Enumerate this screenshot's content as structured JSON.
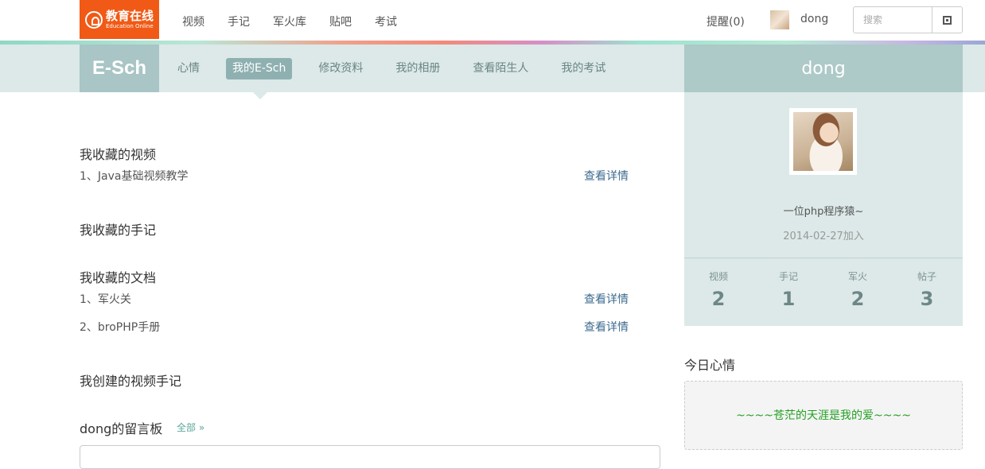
{
  "header": {
    "logo": {
      "cn": "教育在线",
      "en": "Education Online"
    },
    "nav": [
      "视频",
      "手记",
      "军火库",
      "贴吧",
      "考试"
    ],
    "remind": "提醒(0)",
    "username": "dong",
    "search_placeholder": "搜索"
  },
  "subnav": {
    "brand": "E-Sch",
    "items": [
      "心情",
      "我的E-Sch",
      "修改资料",
      "我的相册",
      "查看陌生人",
      "我的考试"
    ],
    "active_index": 1
  },
  "main": {
    "videos_title": "我收藏的视频",
    "videos": [
      {
        "text": "1、Java基础视频教学",
        "link": "查看详情"
      }
    ],
    "notes_title": "我收藏的手记",
    "docs_title": "我收藏的文档",
    "docs": [
      {
        "text": "1、军火关",
        "link": "查看详情"
      },
      {
        "text": "2、broPHP手册",
        "link": "查看详情"
      }
    ],
    "created_title": "我创建的视频手记",
    "board_title": "dong的留言板",
    "board_all": "全部 »"
  },
  "profile": {
    "name": "dong",
    "bio": "一位php程序猿~",
    "joined": "2014-02-27加入",
    "stats": [
      {
        "label": "视频",
        "value": "2"
      },
      {
        "label": "手记",
        "value": "1"
      },
      {
        "label": "军火",
        "value": "2"
      },
      {
        "label": "帖子",
        "value": "3"
      }
    ]
  },
  "mood": {
    "title": "今日心情",
    "text": "~~~~苍茫的天涯是我的爱~~~~"
  },
  "colors": {
    "logo_bg": "#f05a16",
    "subnav_bg": "#dce9e8",
    "accent": "#a9c5c5",
    "link": "#3d6b8f",
    "mood_text": "#22a022"
  }
}
